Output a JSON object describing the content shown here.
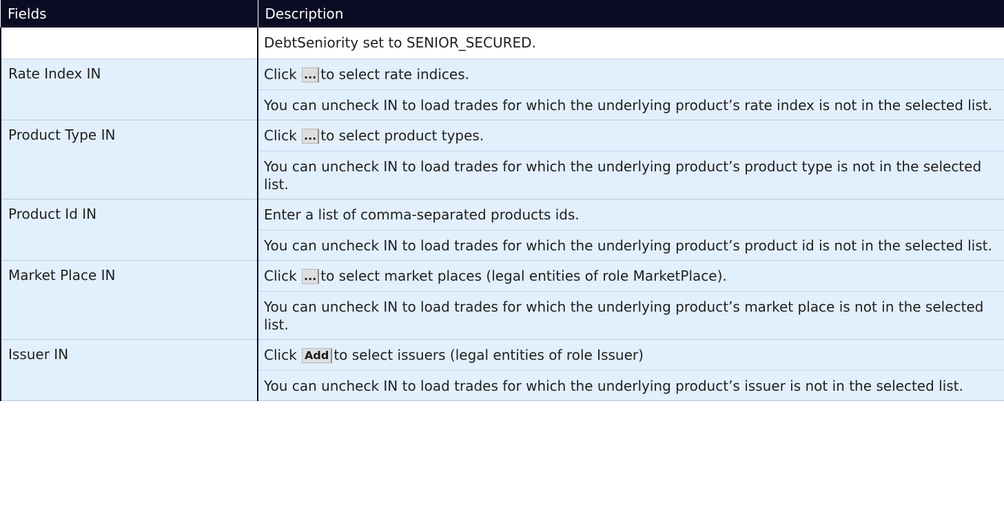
{
  "header": {
    "fields_label": "Fields",
    "description_label": "Description"
  },
  "continuation_text": "DebtSeniority set to SENIOR_SECURED.",
  "rows": [
    {
      "field": "Rate Index IN",
      "line1_before": "Click",
      "button": "...",
      "line1_after": "to select rate indices.",
      "line2": "You can uncheck IN to load trades for which the underlying product’s rate index is not in the selected list."
    },
    {
      "field": "Product Type IN",
      "line1_before": "Click",
      "button": "...",
      "line1_after": "to select product types.",
      "line2": "You can uncheck IN to load trades for which the underlying product’s product type is not in the selected list."
    },
    {
      "field": "Product Id IN",
      "line1_text": "Enter a list of comma-separated products ids.",
      "line2": "You can uncheck IN to load trades for which the underlying product’s product id is not in the selected list."
    },
    {
      "field": "Market Place IN",
      "line1_before": "Click",
      "button": "...",
      "line1_after": "to select market places (legal entities of role MarketPlace).",
      "line2": "You can uncheck IN to load trades for which the underlying product’s market place is not in the selected list."
    },
    {
      "field": "Issuer IN",
      "line1_before": "Click",
      "button": "Add",
      "line1_after": "to select issuers (legal entities of role Issuer)",
      "line2": "You can uncheck IN to load trades for which the underlying product’s issuer is not in the selected list."
    }
  ]
}
